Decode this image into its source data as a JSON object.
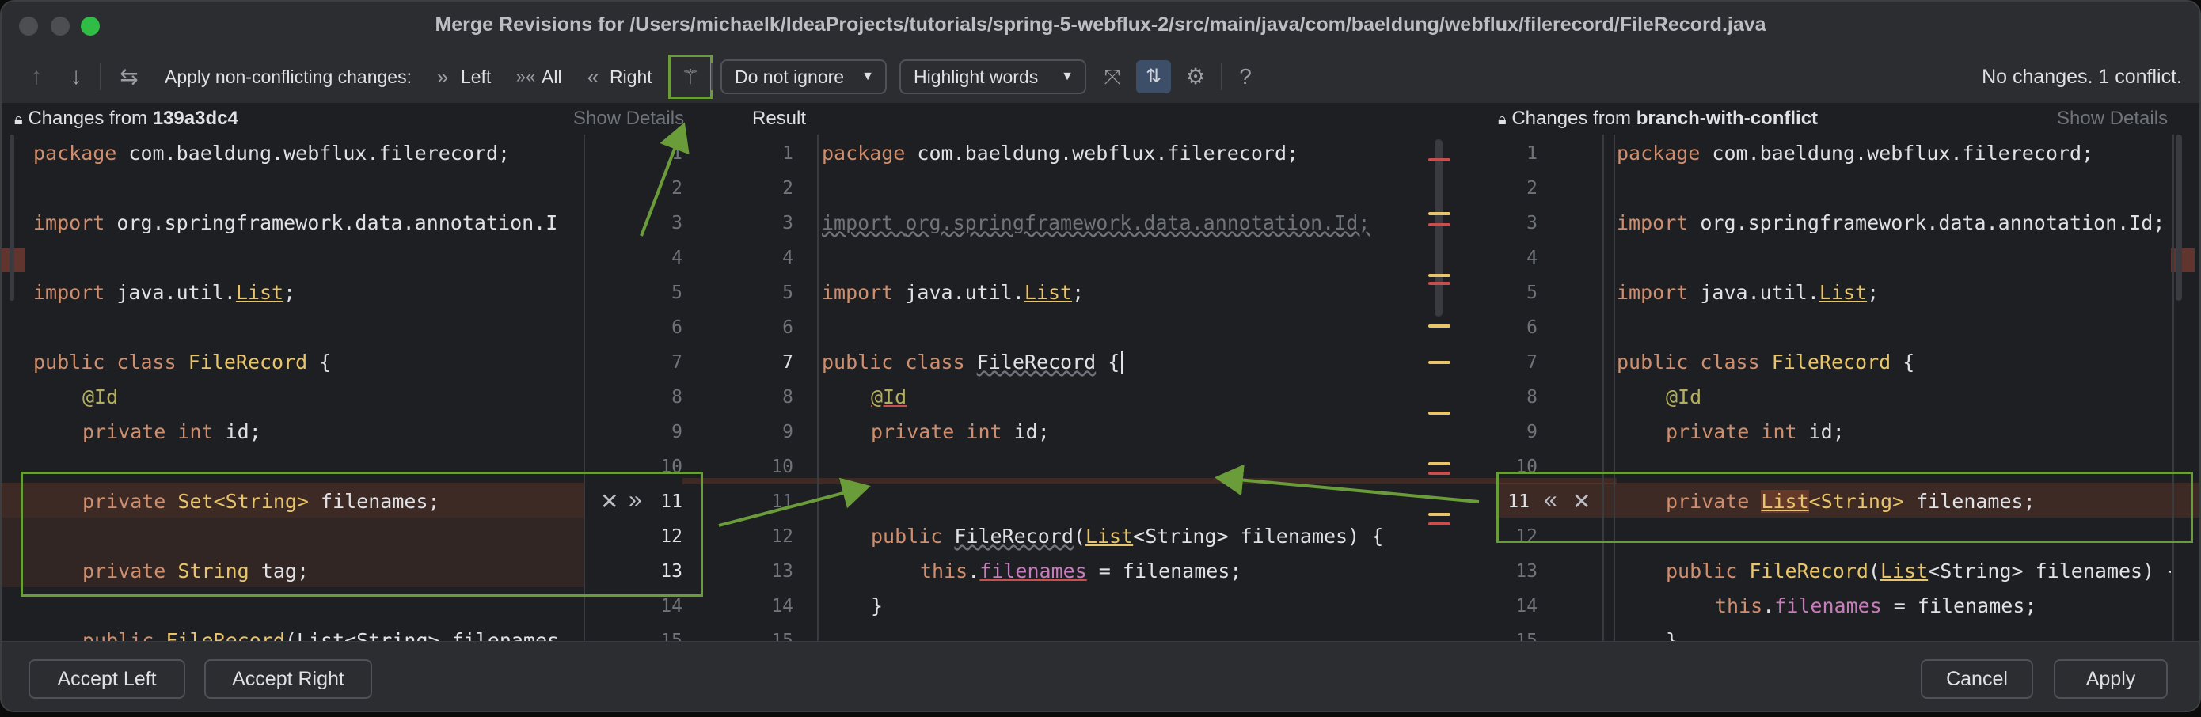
{
  "window": {
    "title": "Merge Revisions for /Users/michaelk/IdeaProjects/tutorials/spring-5-webflux-2/src/main/java/com/baeldung/webflux/filerecord/FileRecord.java"
  },
  "toolbar": {
    "apply_label": "Apply non-conflicting changes:",
    "left_label": "Left",
    "all_label": "All",
    "right_label": "Right",
    "ignore_value": "Do not ignore",
    "highlight_value": "Highlight words",
    "status": "No changes. 1 conflict."
  },
  "panes": {
    "left": {
      "prefix": "Changes from ",
      "revision": "139a3dc4",
      "show_details": "Show Details"
    },
    "center": {
      "title": "Result"
    },
    "right": {
      "prefix": "Changes from ",
      "revision": "branch-with-conflict",
      "show_details": "Show Details"
    }
  },
  "code": {
    "package_kw": "package",
    "package_name": "com.baeldung.webflux.filerecord;",
    "import_kw": "import",
    "import_left": "org.springframework.data.annotation.I",
    "import_full": "org.springframework.data.annotation.Id;",
    "import_right": "org.springframework.data.annotation.Id;",
    "import_list_prefix": "java.util.",
    "list": "List",
    "semicolon": ";",
    "public": "public",
    "class": "class",
    "class_name": "FileRecord",
    "brace_open": " {",
    "at_id": "@Id",
    "private": "private",
    "int": "int",
    "id": " id;",
    "set_string": "Set<String>",
    "filenames_decl": " filenames;",
    "string": "String",
    "tag": " tag;",
    "list_string_tail": "<String>",
    "ctor_public": "public",
    "ctor_name": "FileRecord",
    "ctor_params_left": "(List<String> filenames",
    "ctor_args": "<String> filenames) {",
    "this": "this",
    "dot": ".",
    "filenames": "filenames",
    "assign": " = filenames;",
    "close_brace": "}"
  },
  "line_numbers": {
    "left": [
      "1",
      "2",
      "3",
      "4",
      "5",
      "6",
      "7",
      "8",
      "9",
      "10",
      "11",
      "12",
      "13",
      "14",
      "15"
    ],
    "center": [
      "1",
      "2",
      "3",
      "4",
      "5",
      "6",
      "7",
      "8",
      "9",
      "10",
      "11",
      "12",
      "13",
      "14",
      "15"
    ],
    "right": [
      "1",
      "2",
      "3",
      "4",
      "5",
      "6",
      "7",
      "8",
      "9",
      "10",
      "11",
      "12",
      "13",
      "14",
      "15"
    ]
  },
  "footer": {
    "accept_left": "Accept Left",
    "accept_right": "Accept Right",
    "cancel": "Cancel",
    "apply": "Apply"
  },
  "colors": {
    "accent_green": "#6b9c3a",
    "conflict_red": "#c94f4f",
    "change_yellow": "#e8c46a"
  }
}
